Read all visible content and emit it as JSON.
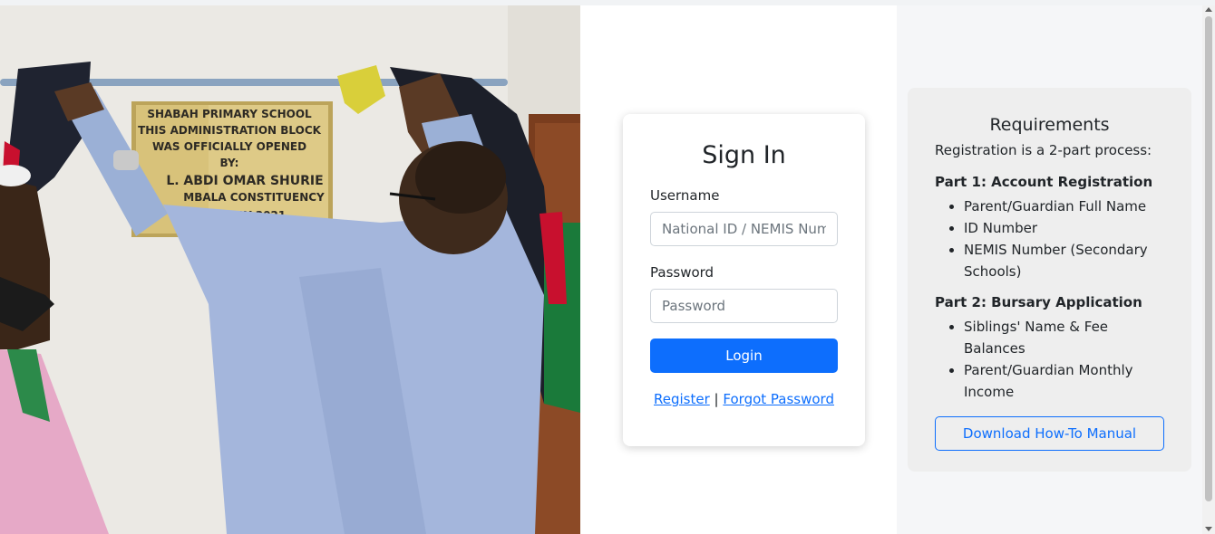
{
  "photo": {
    "alt_icon": "photo-plaque-unveiling",
    "plaque_lines": [
      "SHABAH PRIMARY SCHOOL",
      "THIS ADMINISTRATION BLOCK",
      "WAS OFFICIALLY OPENED",
      "BY:",
      "L. ABDI OMAR SHURIE",
      "MBALA CONSTITUENCY",
      "H JULY 2021"
    ]
  },
  "signin": {
    "title": "Sign In",
    "username_label": "Username",
    "username_placeholder": "National ID / NEMIS Number",
    "password_label": "Password",
    "password_placeholder": "Password",
    "login_label": "Login",
    "register_link": "Register",
    "separator": "|",
    "forgot_link": "Forgot Password"
  },
  "requirements": {
    "title": "Requirements",
    "intro": "Registration is a 2-part process:",
    "parts": [
      {
        "title": "Part 1: Account Registration",
        "items": [
          "Parent/Guardian Full Name",
          "ID Number",
          "NEMIS Number (Secondary Schools)"
        ]
      },
      {
        "title": "Part 2: Bursary Application",
        "items": [
          "Siblings' Name & Fee Balances",
          "Parent/Guardian Monthly Income"
        ]
      }
    ],
    "download_label": "Download How-To Manual"
  },
  "colors": {
    "primary": "#0d6efd",
    "panel_bg": "#f5f6f8",
    "card_bg": "#eeeeee"
  }
}
